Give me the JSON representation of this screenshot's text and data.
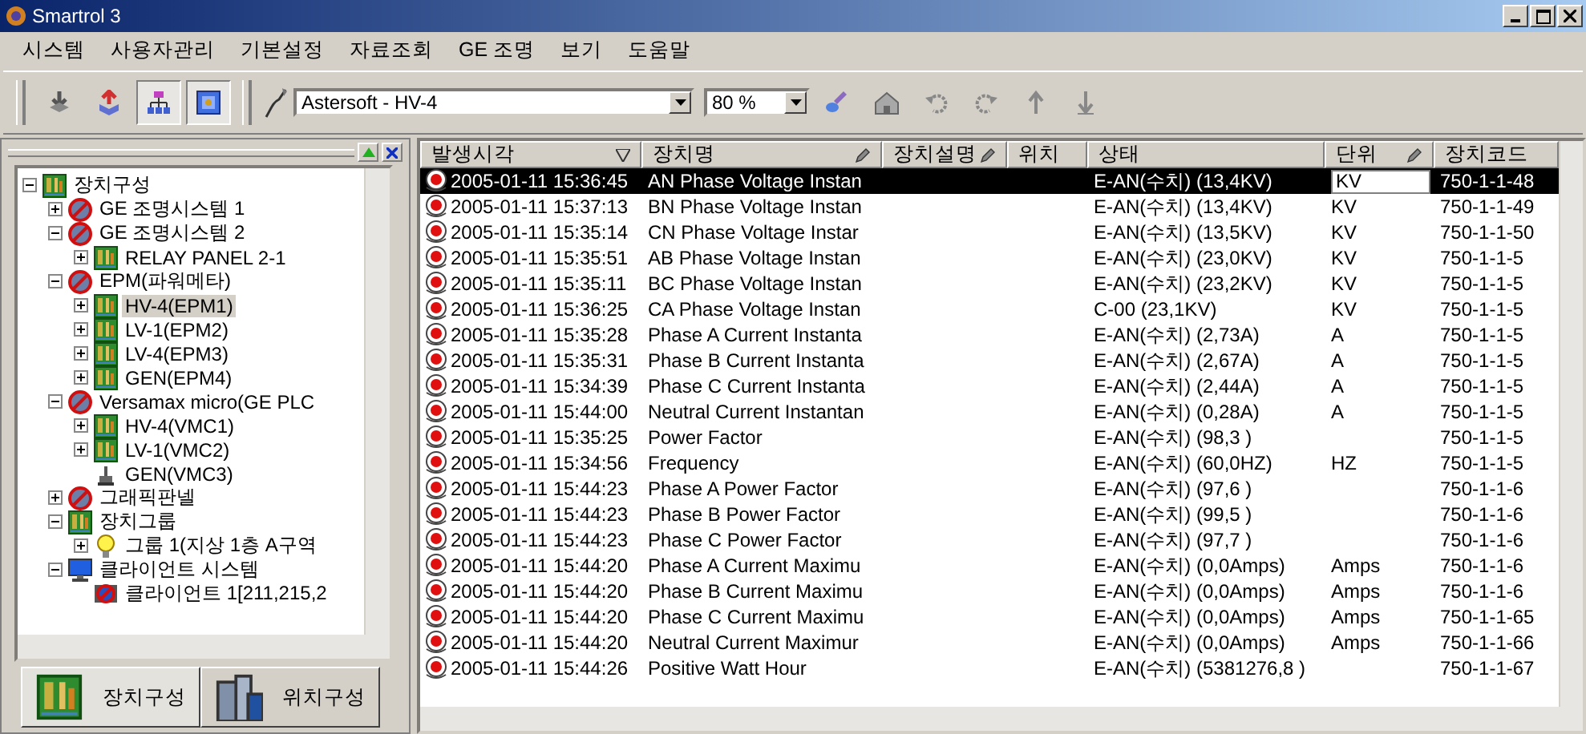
{
  "window": {
    "title": "Smartrol 3"
  },
  "menu": [
    "시스템",
    "사용자관리",
    "기본설정",
    "자료조회",
    "GE 조명",
    "보기",
    "도움말"
  ],
  "toolbar": {
    "left_buttons": [
      {
        "kind": "download",
        "pressed": false
      },
      {
        "kind": "upload",
        "pressed": false
      },
      {
        "kind": "network",
        "pressed": true
      },
      {
        "kind": "picture",
        "pressed": true
      }
    ],
    "device_combo": {
      "value": "Astersoft - HV-4"
    },
    "zoom_combo": {
      "value": "80 %"
    },
    "right_buttons": [
      {
        "kind": "brush",
        "pressed": false
      },
      {
        "kind": "house",
        "pressed": false
      },
      {
        "kind": "undo",
        "pressed": false
      },
      {
        "kind": "redo",
        "pressed": false
      },
      {
        "kind": "up",
        "pressed": false
      },
      {
        "kind": "down",
        "pressed": false
      }
    ]
  },
  "tree": [
    {
      "label": "장치구성",
      "kind": "board",
      "expanded": true,
      "selected": false,
      "children": [
        {
          "label": "GE 조명시스템 1",
          "kind": "blocked",
          "expanded": false,
          "selected": false
        },
        {
          "label": "GE 조명시스템 2",
          "kind": "blocked",
          "expanded": true,
          "selected": false,
          "children": [
            {
              "label": "RELAY PANEL 2-1",
              "kind": "board",
              "expanded": false,
              "selected": false
            }
          ]
        },
        {
          "label": "EPM(파워메타)",
          "kind": "blocked",
          "expanded": true,
          "selected": false,
          "children": [
            {
              "label": "HV-4(EPM1)",
              "kind": "board",
              "expanded": false,
              "selected": true
            },
            {
              "label": "LV-1(EPM2)",
              "kind": "board",
              "expanded": false,
              "selected": false
            },
            {
              "label": "LV-4(EPM3)",
              "kind": "board",
              "expanded": false,
              "selected": false
            },
            {
              "label": "GEN(EPM4)",
              "kind": "board",
              "expanded": false,
              "selected": false
            }
          ]
        },
        {
          "label": "Versamax micro(GE PLC",
          "kind": "blocked",
          "expanded": true,
          "selected": false,
          "children": [
            {
              "label": "HV-4(VMC1)",
              "kind": "board",
              "expanded": false,
              "selected": false
            },
            {
              "label": "LV-1(VMC2)",
              "kind": "board",
              "expanded": false,
              "selected": false
            },
            {
              "label": "GEN(VMC3)",
              "kind": "plug",
              "selected": false
            }
          ]
        },
        {
          "label": "그래픽판넬",
          "kind": "blocked",
          "expanded": false,
          "selected": false
        },
        {
          "label": "장치그룹",
          "kind": "board",
          "expanded": true,
          "selected": false,
          "children": [
            {
              "label": "그룹 1(지상 1층 A구역",
              "kind": "bulb",
              "expanded": false,
              "selected": false
            }
          ]
        },
        {
          "label": "클라이언트 시스템",
          "kind": "monitor",
          "expanded": true,
          "selected": false,
          "children": [
            {
              "label": "클라이언트 1[211,215,2",
              "kind": "client",
              "selected": false
            }
          ]
        }
      ]
    }
  ],
  "panel_tabs": [
    {
      "label": "장치구성",
      "kind": "board",
      "selected": true
    },
    {
      "label": "위치구성",
      "kind": "building",
      "selected": false
    }
  ],
  "table": {
    "columns": [
      {
        "label": "발생시각",
        "kind": "sort"
      },
      {
        "label": "장치명",
        "kind": "pencil"
      },
      {
        "label": "장치설명",
        "kind": "pencil"
      },
      {
        "label": "위치"
      },
      {
        "label": "상태"
      },
      {
        "label": "단위",
        "kind": "pencil"
      },
      {
        "label": "장치코드"
      }
    ],
    "rows": [
      {
        "time": "2005-01-11 15:36:45",
        "name": "AN Phase Voltage Instan",
        "status": "E-AN(수치) (13,4KV)",
        "unit": "KV",
        "code": "750-1-1-48",
        "selected": true,
        "editing": true
      },
      {
        "time": "2005-01-11 15:37:13",
        "name": "BN Phase Voltage Instan",
        "status": "E-AN(수치) (13,4KV)",
        "unit": "KV",
        "code": "750-1-1-49",
        "selected": false,
        "editing": false
      },
      {
        "time": "2005-01-11 15:35:14",
        "name": "CN Phase Voltage Instar",
        "status": "E-AN(수치) (13,5KV)",
        "unit": "KV",
        "code": "750-1-1-50",
        "selected": false,
        "editing": false
      },
      {
        "time": "2005-01-11 15:35:51",
        "name": "AB Phase Voltage Instan",
        "status": "E-AN(수치) (23,0KV)",
        "unit": "KV",
        "code": "750-1-1-5",
        "selected": false,
        "editing": false
      },
      {
        "time": "2005-01-11 15:35:11",
        "name": "BC Phase Voltage Instan",
        "status": "E-AN(수치) (23,2KV)",
        "unit": "KV",
        "code": "750-1-1-5",
        "selected": false,
        "editing": false
      },
      {
        "time": "2005-01-11 15:36:25",
        "name": "CA Phase Voltage Instan",
        "status": "C-00 (23,1KV)",
        "unit": "KV",
        "code": "750-1-1-5",
        "selected": false,
        "editing": false
      },
      {
        "time": "2005-01-11 15:35:28",
        "name": "Phase A Current Instanta",
        "status": "E-AN(수치) (2,73A)",
        "unit": "A",
        "code": "750-1-1-5",
        "selected": false,
        "editing": false
      },
      {
        "time": "2005-01-11 15:35:31",
        "name": "Phase B Current Instanta",
        "status": "E-AN(수치) (2,67A)",
        "unit": "A",
        "code": "750-1-1-5",
        "selected": false,
        "editing": false
      },
      {
        "time": "2005-01-11 15:34:39",
        "name": "Phase C Current Instanta",
        "status": "E-AN(수치) (2,44A)",
        "unit": "A",
        "code": "750-1-1-5",
        "selected": false,
        "editing": false
      },
      {
        "time": "2005-01-11 15:44:00",
        "name": "Neutral Current Instantan",
        "status": "E-AN(수치) (0,28A)",
        "unit": "A",
        "code": "750-1-1-5",
        "selected": false,
        "editing": false
      },
      {
        "time": "2005-01-11 15:35:25",
        "name": "Power Factor",
        "status": "E-AN(수치) (98,3 )",
        "code": "750-1-1-5",
        "selected": false,
        "editing": false
      },
      {
        "time": "2005-01-11 15:34:56",
        "name": "Frequency",
        "status": "E-AN(수치) (60,0HZ)",
        "unit": "HZ",
        "code": "750-1-1-5",
        "selected": false,
        "editing": false
      },
      {
        "time": "2005-01-11 15:44:23",
        "name": "Phase A Power Factor",
        "status": "E-AN(수치) (97,6 )",
        "code": "750-1-1-6",
        "selected": false,
        "editing": false
      },
      {
        "time": "2005-01-11 15:44:23",
        "name": "Phase B Power Factor",
        "status": "E-AN(수치) (99,5 )",
        "code": "750-1-1-6",
        "selected": false,
        "editing": false
      },
      {
        "time": "2005-01-11 15:44:23",
        "name": "Phase C Power Factor",
        "status": "E-AN(수치) (97,7 )",
        "code": "750-1-1-6",
        "selected": false,
        "editing": false
      },
      {
        "time": "2005-01-11 15:44:20",
        "name": "Phase A Current Maximu",
        "status": "E-AN(수치) (0,0Amps)",
        "unit": "Amps",
        "code": "750-1-1-6",
        "selected": false,
        "editing": false
      },
      {
        "time": "2005-01-11 15:44:20",
        "name": "Phase B Current Maximu",
        "status": "E-AN(수치) (0,0Amps)",
        "unit": "Amps",
        "code": "750-1-1-6",
        "selected": false,
        "editing": false
      },
      {
        "time": "2005-01-11 15:44:20",
        "name": "Phase C Current Maximu",
        "status": "E-AN(수치) (0,0Amps)",
        "unit": "Amps",
        "code": "750-1-1-65",
        "selected": false,
        "editing": false
      },
      {
        "time": "2005-01-11 15:44:20",
        "name": "Neutral Current Maximur",
        "status": "E-AN(수치) (0,0Amps)",
        "unit": "Amps",
        "code": "750-1-1-66",
        "selected": false,
        "editing": false
      },
      {
        "time": "2005-01-11 15:44:26",
        "name": "Positive Watt Hour",
        "status": "E-AN(수치) (5381276,8 )",
        "code": "750-1-1-67",
        "selected": false,
        "editing": false
      }
    ]
  }
}
